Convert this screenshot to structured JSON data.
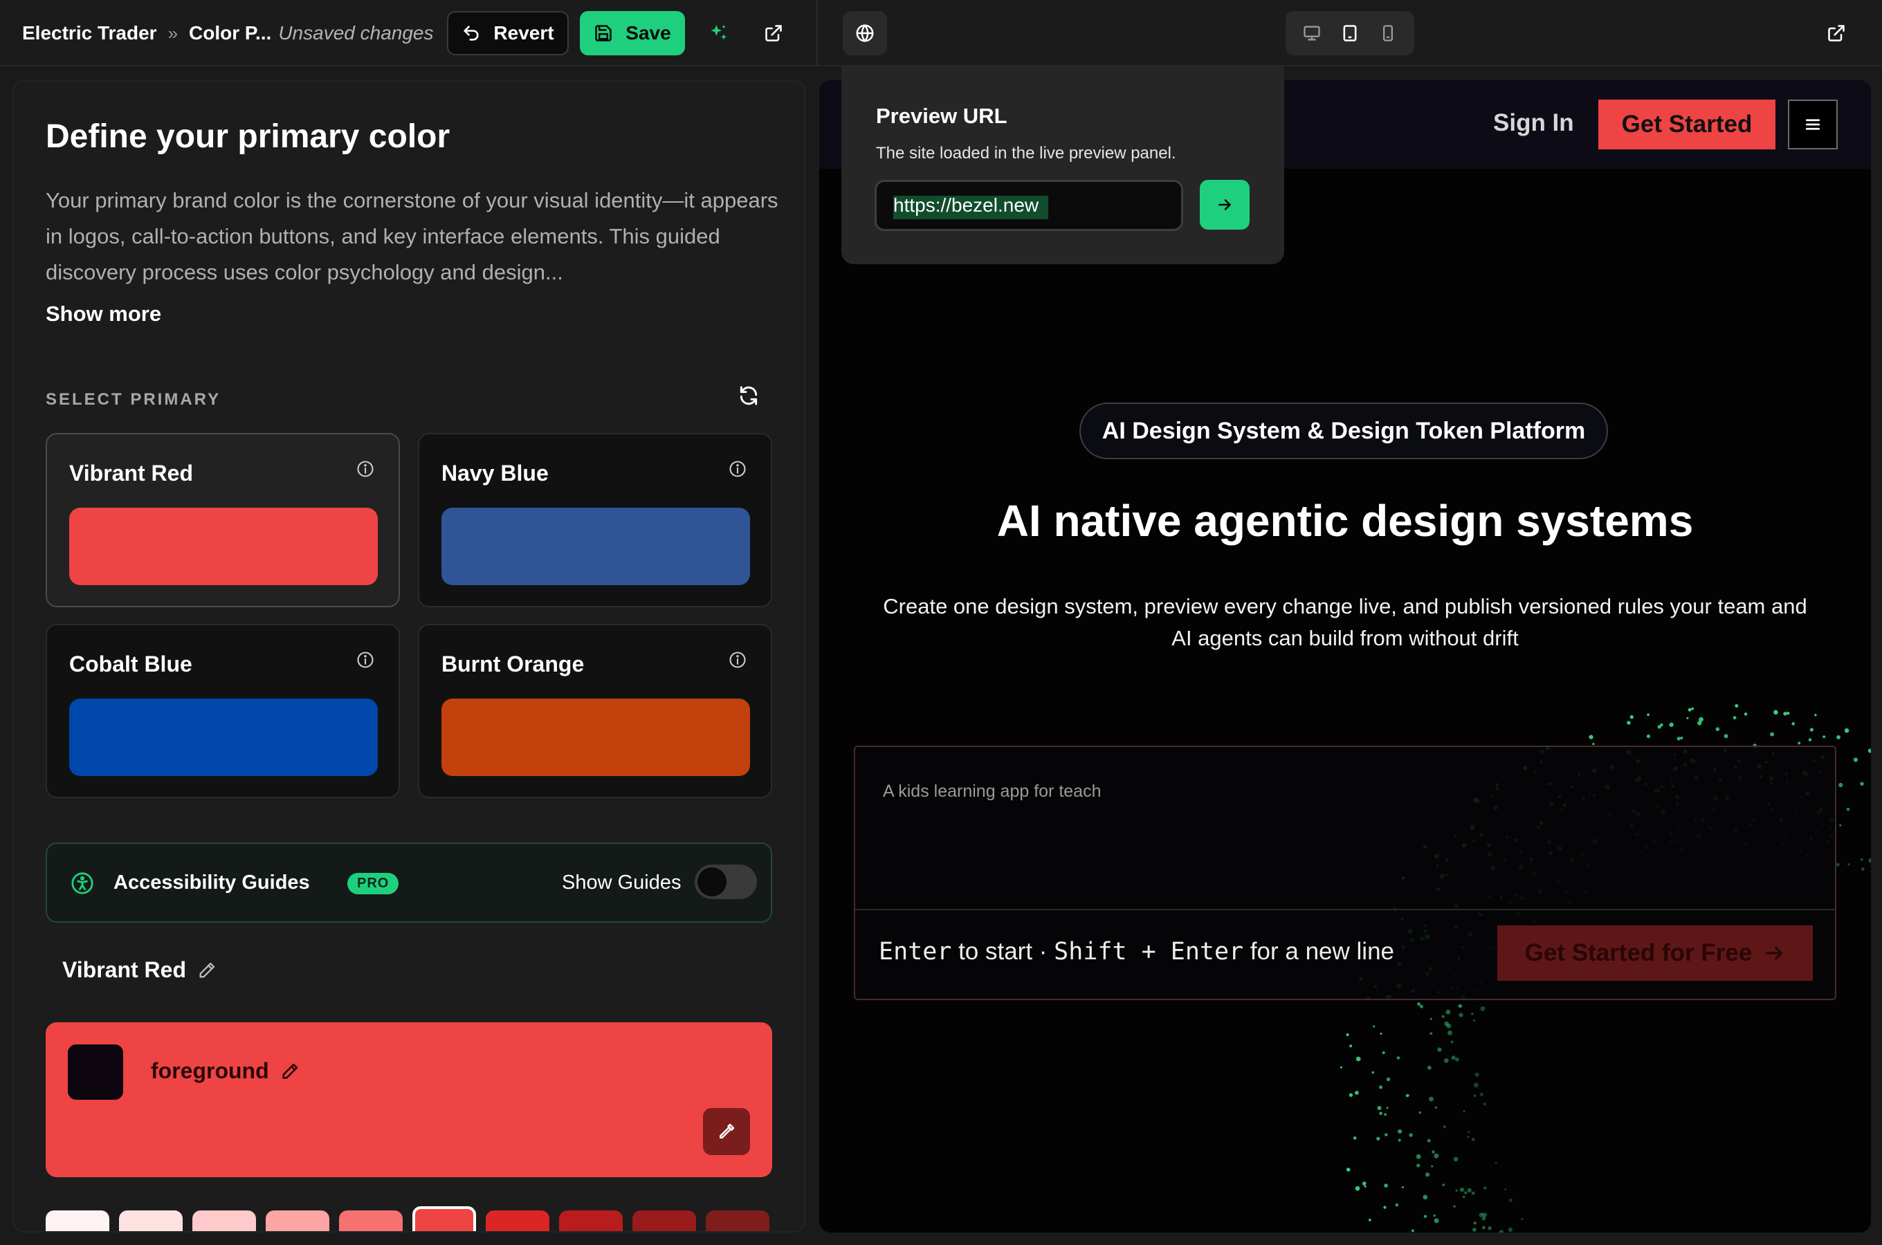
{
  "topbar": {
    "project": "Electric Trader",
    "page": "Color P...",
    "status": "Unsaved changes",
    "revert_label": "Revert",
    "save_label": "Save"
  },
  "popover": {
    "title": "Preview URL",
    "subtitle": "The site loaded in the live preview panel.",
    "url_value": "https://bezel.new"
  },
  "left": {
    "title": "Define your primary color",
    "description": "Your primary brand color is the cornerstone of your visual identity—it appears in logos, call-to-action buttons, and key interface elements. This guided discovery process uses color psychology and design...",
    "show_more": "Show more",
    "select_label": "SELECT PRIMARY",
    "cards": [
      {
        "name": "Vibrant Red",
        "color": "#ef4444",
        "selected": true
      },
      {
        "name": "Navy Blue",
        "color": "#2f5597",
        "selected": false
      },
      {
        "name": "Cobalt Blue",
        "color": "#0047ab",
        "selected": false
      },
      {
        "name": "Burnt Orange",
        "color": "#c2410c",
        "selected": false
      }
    ],
    "a11y": {
      "label": "Accessibility Guides",
      "badge": "PRO",
      "toggle_label": "Show Guides",
      "toggle_on": false
    },
    "selected_name": "Vibrant Red",
    "foreground_label": "foreground",
    "shades": [
      "#fef2f2",
      "#fee2e2",
      "#fecaca",
      "#fca5a5",
      "#f87171",
      "#ef4444",
      "#dc2626",
      "#b91c1c",
      "#991b1b",
      "#7f1d1d"
    ]
  },
  "preview": {
    "signin": "Sign In",
    "get_started": "Get Started",
    "pill": "AI Design System & Design Token Platform",
    "hero_title": "AI native agentic design systems",
    "hero_sub": "Create one design system, preview every change live, and publish versioned rules your team and AI agents can build from without drift",
    "prompt_placeholder": "A kids learning app for teach",
    "hint_enter": "Enter",
    "hint_start": " to start · ",
    "hint_shift": "Shift",
    "hint_plus": " + ",
    "hint_enter2": "Enter",
    "hint_newline": " for a new line",
    "cta": "Get Started for Free"
  }
}
